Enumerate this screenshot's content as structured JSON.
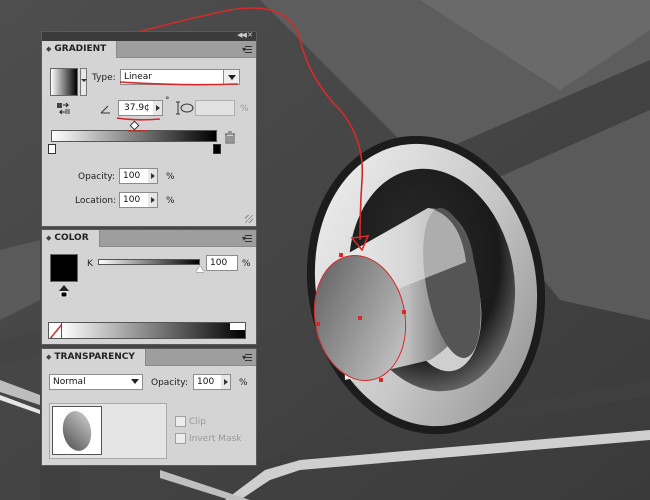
{
  "colors": {
    "annotation_red": "#d42a2a",
    "panel_bg": "#d4d4d4",
    "panel_tab_bar": "#9e9e9e",
    "panel_topbar": "#3b3b3b"
  },
  "gradient_panel": {
    "tab_label": "GRADIENT",
    "type_label": "Type:",
    "type_value": "Linear",
    "angle_value": "37.9¢",
    "aspect_unit": "%",
    "opacity_label": "Opacity:",
    "opacity_value": "100",
    "opacity_unit": "%",
    "location_label": "Location:",
    "location_value": "100",
    "location_unit": "%",
    "icons": [
      "reverse-gradient-icon",
      "angle-icon",
      "aspect-ratio-icon",
      "trash-icon",
      "color-stop-icon",
      "midpoint-diamond-icon"
    ]
  },
  "color_panel": {
    "tab_label": "COLOR",
    "channel_label": "K",
    "channel_value": "100",
    "channel_unit": "%",
    "slider_level": 1.0,
    "icons": [
      "out-of-gamut-icon",
      "none-swatch-icon"
    ]
  },
  "transparency_panel": {
    "tab_label": "TRANSPARENCY",
    "blend_mode": "Normal",
    "opacity_label": "Opacity:",
    "opacity_value": "100",
    "opacity_unit": "%",
    "clip_label": "Clip",
    "invert_mask_label": "Invert Mask",
    "clip_checked": false,
    "invert_mask_checked": false
  }
}
